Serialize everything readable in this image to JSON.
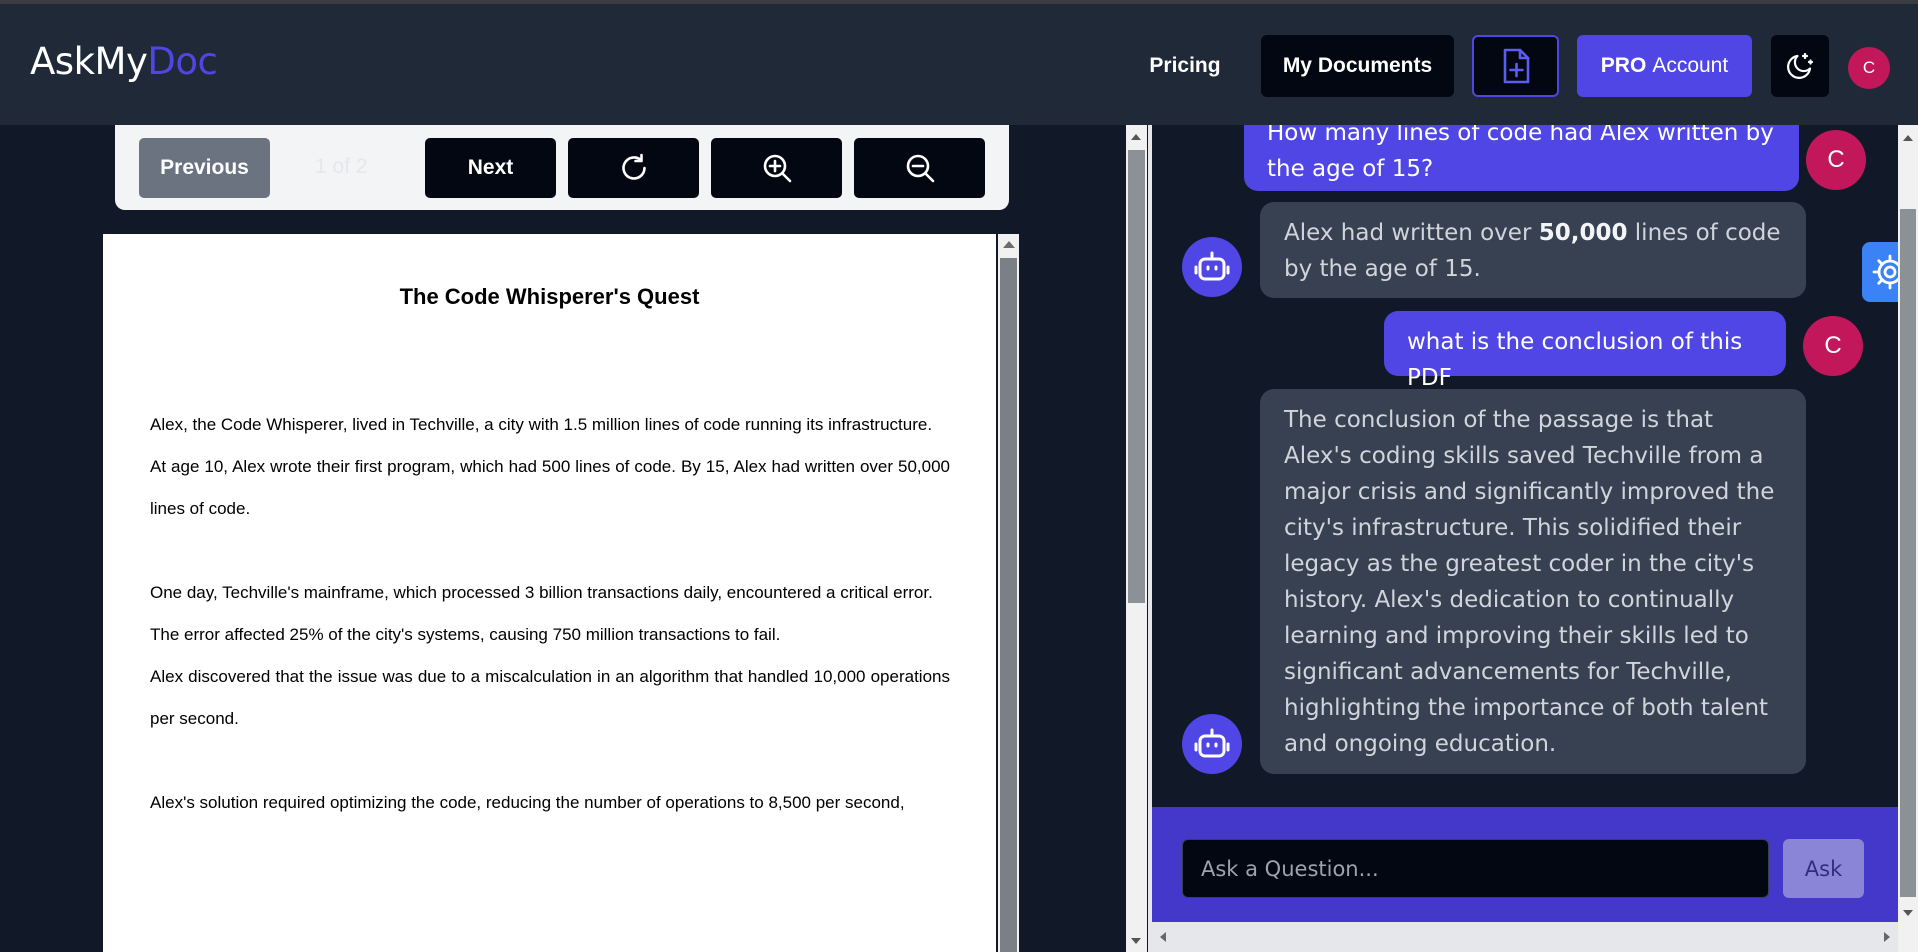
{
  "app": {
    "logo_part1": "AskMy",
    "logo_part2": "Doc",
    "accent_color": "#4f46e5"
  },
  "nav": {
    "pricing": "Pricing",
    "my_documents": "My Documents",
    "pro_bold": "PRO",
    "pro_rest": "Account",
    "avatar_initial": "C",
    "icons": [
      "file-plus-icon",
      "moon-stars-icon"
    ]
  },
  "viewer": {
    "previous": "Previous",
    "page_indicator": "1 of 2",
    "next": "Next",
    "icons": [
      "rotate-icon",
      "zoom-in-icon",
      "zoom-out-icon"
    ]
  },
  "pdf": {
    "title": "The Code Whisperer's Quest",
    "paragraphs": [
      "Alex, the Code Whisperer, lived in Techville, a city with 1.5 million lines of code running its infrastructure.",
      "At age 10, Alex wrote their first program, which had 500 lines of code. By 15, Alex had written over 50,000 lines of code.",
      "One day, Techville's mainframe, which processed 3 billion transactions daily, encountered a critical error.",
      "The error affected 25% of the city's systems, causing 750 million transactions to fail.",
      "Alex discovered that the issue was due to a miscalculation in an algorithm that handled 10,000 operations per second.",
      "Alex's solution required optimizing the code, reducing the number of operations to 8,500 per second,"
    ]
  },
  "chat": {
    "messages": [
      {
        "role": "user",
        "text": "How many lines of code had Alex written by the age of 15?"
      },
      {
        "role": "bot",
        "text_before": "Alex had written over ",
        "text_bold": "50,000",
        "text_after": " lines of code by the age of 15."
      },
      {
        "role": "user",
        "text": "what is the conclusion of this PDF"
      },
      {
        "role": "bot",
        "text": "The conclusion of the passage is that Alex's coding skills saved Techville from a major crisis and significantly improved the city's infrastructure. This solidified their legacy as the greatest coder in the city's history. Alex's dedication to continually learning and improving their skills led to significant advancements for Techville, highlighting the importance of both talent and ongoing education."
      }
    ],
    "user_initial": "C",
    "input_placeholder": "Ask a Question...",
    "ask_label": "Ask"
  }
}
